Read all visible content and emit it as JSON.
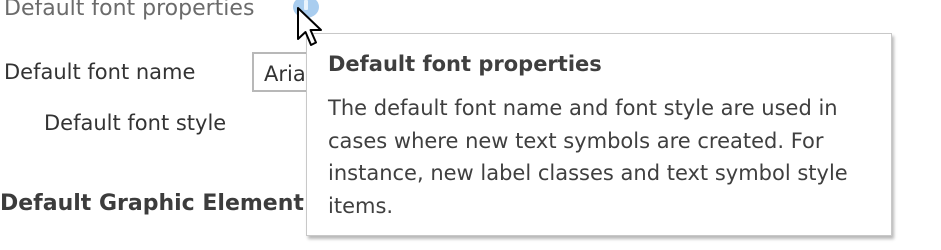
{
  "section": {
    "title": "Default font properties",
    "info_icon": "info-icon"
  },
  "fields": {
    "font_name_label": "Default font name",
    "font_name_value": "Aria",
    "font_style_label": "Default font style"
  },
  "subsection": {
    "title": "Default Graphic Element S"
  },
  "tooltip": {
    "title": "Default font properties",
    "body": "The default font name and font style are used in cases where new text symbols are created. For instance, new label classes and text symbol style items."
  },
  "cursor": {
    "icon": "mouse-pointer-icon"
  },
  "colors": {
    "info_icon": "#a9cdef",
    "border": "#b8b8b8",
    "text": "#333333"
  }
}
